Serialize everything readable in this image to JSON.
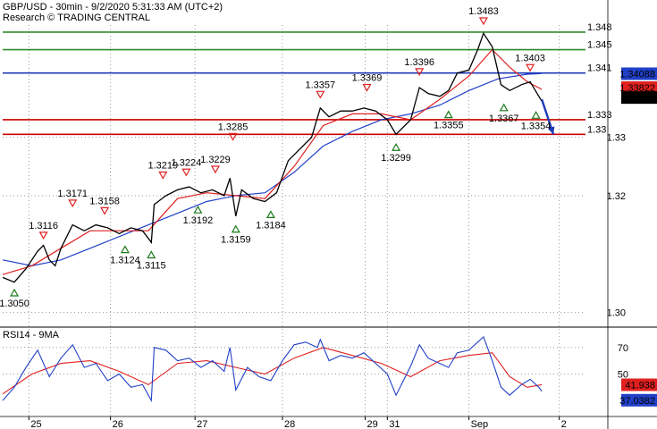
{
  "header": {
    "title": "GBP/USD - 30min - 9/2/2020 5:31:33 AM (UTC+2)",
    "subtitle": "Research © TRADING CENTRAL"
  },
  "colors": {
    "resistance": "#2e8b2e",
    "pivot": "#1f3ab8",
    "support": "#cc0000",
    "ma_red": "#e02020",
    "ma_blue": "#2040c8",
    "price": "#000000",
    "marker_down": "#e02020",
    "marker_up": "#1a7a1a",
    "grid": "#9a9a9a"
  },
  "icons": {
    "forecast_arrow": "arrow-down-right-icon",
    "marker_high": "triangle-down-icon",
    "marker_low": "triangle-up-icon"
  },
  "chart_data": [
    {
      "type": "line",
      "panel": "price",
      "ylim": [
        1.2975,
        1.3535
      ],
      "y_ticks": [
        "1.33",
        "1.32",
        "1.30"
      ],
      "x_ticks": [
        "25",
        "26",
        "27",
        "28",
        "29",
        "31",
        "Sep",
        "2"
      ],
      "levels": [
        {
          "label": "1.348",
          "value": 1.348,
          "role": "resistance"
        },
        {
          "label": "1.345",
          "value": 1.345,
          "role": "resistance"
        },
        {
          "label": "1.341",
          "value": 1.341,
          "role": "pivot"
        },
        {
          "label": "1.333",
          "value": 1.333,
          "role": "support"
        },
        {
          "label": "1.33",
          "value": 1.3305,
          "role": "support"
        }
      ],
      "last_price": "1.337",
      "ma_fast_value": "1.33822",
      "ma_slow_value": "1.34088",
      "annotations": [
        {
          "label": "1.3050",
          "value": 1.305,
          "type": "low",
          "x_pos": 0.02
        },
        {
          "label": "1.3116",
          "value": 1.3116,
          "type": "high",
          "x_pos": 0.07
        },
        {
          "label": "1.3171",
          "value": 1.3171,
          "type": "high",
          "x_pos": 0.12
        },
        {
          "label": "1.3158",
          "value": 1.3158,
          "type": "high",
          "x_pos": 0.175
        },
        {
          "label": "1.3124",
          "value": 1.3124,
          "type": "low",
          "x_pos": 0.21
        },
        {
          "label": "1.3115",
          "value": 1.3115,
          "type": "low",
          "x_pos": 0.255
        },
        {
          "label": "1.3219",
          "value": 1.3219,
          "type": "high",
          "x_pos": 0.275
        },
        {
          "label": "1.3224",
          "value": 1.3224,
          "type": "high",
          "x_pos": 0.315
        },
        {
          "label": "1.3192",
          "value": 1.3192,
          "type": "low",
          "x_pos": 0.335
        },
        {
          "label": "1.3229",
          "value": 1.3229,
          "type": "high",
          "x_pos": 0.365
        },
        {
          "label": "1.3285",
          "value": 1.3285,
          "type": "high",
          "x_pos": 0.395
        },
        {
          "label": "1.3159",
          "value": 1.3159,
          "type": "low",
          "x_pos": 0.4
        },
        {
          "label": "1.3184",
          "value": 1.3184,
          "type": "low",
          "x_pos": 0.46
        },
        {
          "label": "1.3357",
          "value": 1.3357,
          "type": "high",
          "x_pos": 0.545
        },
        {
          "label": "1.3369",
          "value": 1.3369,
          "type": "high",
          "x_pos": 0.625
        },
        {
          "label": "1.3299",
          "value": 1.3299,
          "type": "low",
          "x_pos": 0.675
        },
        {
          "label": "1.3396",
          "value": 1.3396,
          "type": "high",
          "x_pos": 0.715
        },
        {
          "label": "1.3355",
          "value": 1.3355,
          "type": "low",
          "x_pos": 0.765
        },
        {
          "label": "1.3483",
          "value": 1.3483,
          "type": "high",
          "x_pos": 0.825
        },
        {
          "label": "1.3367",
          "value": 1.3367,
          "type": "low",
          "x_pos": 0.86
        },
        {
          "label": "1.3403",
          "value": 1.3403,
          "type": "high",
          "x_pos": 0.905
        },
        {
          "label": "1.3354",
          "value": 1.3354,
          "type": "low",
          "x_pos": 0.915
        }
      ],
      "price_series": [
        [
          0.0,
          1.306
        ],
        [
          0.02,
          1.3052
        ],
        [
          0.04,
          1.3075
        ],
        [
          0.06,
          1.3105
        ],
        [
          0.07,
          1.3115
        ],
        [
          0.08,
          1.309
        ],
        [
          0.09,
          1.308
        ],
        [
          0.1,
          1.311
        ],
        [
          0.12,
          1.315
        ],
        [
          0.14,
          1.314
        ],
        [
          0.16,
          1.315
        ],
        [
          0.18,
          1.3145
        ],
        [
          0.2,
          1.3135
        ],
        [
          0.22,
          1.3145
        ],
        [
          0.24,
          1.314
        ],
        [
          0.255,
          1.312
        ],
        [
          0.26,
          1.3185
        ],
        [
          0.28,
          1.32
        ],
        [
          0.3,
          1.321
        ],
        [
          0.32,
          1.3215
        ],
        [
          0.34,
          1.3205
        ],
        [
          0.36,
          1.321
        ],
        [
          0.38,
          1.32
        ],
        [
          0.39,
          1.323
        ],
        [
          0.4,
          1.3165
        ],
        [
          0.41,
          1.321
        ],
        [
          0.43,
          1.3195
        ],
        [
          0.45,
          1.319
        ],
        [
          0.47,
          1.3205
        ],
        [
          0.49,
          1.326
        ],
        [
          0.51,
          1.328
        ],
        [
          0.53,
          1.33
        ],
        [
          0.545,
          1.335
        ],
        [
          0.56,
          1.3335
        ],
        [
          0.58,
          1.3345
        ],
        [
          0.6,
          1.3345
        ],
        [
          0.62,
          1.335
        ],
        [
          0.64,
          1.3345
        ],
        [
          0.66,
          1.333
        ],
        [
          0.675,
          1.3305
        ],
        [
          0.7,
          1.333
        ],
        [
          0.715,
          1.3385
        ],
        [
          0.73,
          1.3375
        ],
        [
          0.75,
          1.337
        ],
        [
          0.765,
          1.338
        ],
        [
          0.78,
          1.341
        ],
        [
          0.8,
          1.3415
        ],
        [
          0.815,
          1.345
        ],
        [
          0.825,
          1.3478
        ],
        [
          0.84,
          1.3455
        ],
        [
          0.855,
          1.339
        ],
        [
          0.87,
          1.338
        ],
        [
          0.89,
          1.339
        ],
        [
          0.905,
          1.3395
        ],
        [
          0.92,
          1.337
        ],
        [
          0.925,
          1.3362
        ]
      ],
      "ma_fast_series": [
        [
          0.0,
          1.3065
        ],
        [
          0.05,
          1.308
        ],
        [
          0.1,
          1.311
        ],
        [
          0.15,
          1.314
        ],
        [
          0.2,
          1.314
        ],
        [
          0.25,
          1.314
        ],
        [
          0.3,
          1.3195
        ],
        [
          0.35,
          1.3205
        ],
        [
          0.4,
          1.32
        ],
        [
          0.45,
          1.3195
        ],
        [
          0.5,
          1.325
        ],
        [
          0.55,
          1.332
        ],
        [
          0.6,
          1.334
        ],
        [
          0.65,
          1.334
        ],
        [
          0.7,
          1.333
        ],
        [
          0.75,
          1.3365
        ],
        [
          0.8,
          1.3405
        ],
        [
          0.84,
          1.345
        ],
        [
          0.87,
          1.342
        ],
        [
          0.9,
          1.3395
        ],
        [
          0.925,
          1.3382
        ]
      ],
      "ma_slow_series": [
        [
          0.0,
          1.309
        ],
        [
          0.05,
          1.308
        ],
        [
          0.1,
          1.309
        ],
        [
          0.15,
          1.311
        ],
        [
          0.2,
          1.313
        ],
        [
          0.25,
          1.315
        ],
        [
          0.3,
          1.317
        ],
        [
          0.35,
          1.319
        ],
        [
          0.4,
          1.32
        ],
        [
          0.45,
          1.3205
        ],
        [
          0.5,
          1.324
        ],
        [
          0.55,
          1.3285
        ],
        [
          0.6,
          1.331
        ],
        [
          0.65,
          1.333
        ],
        [
          0.7,
          1.334
        ],
        [
          0.75,
          1.3355
        ],
        [
          0.8,
          1.338
        ],
        [
          0.85,
          1.34
        ],
        [
          0.9,
          1.3408
        ],
        [
          0.925,
          1.3409
        ]
      ],
      "forecast": [
        [
          0.925,
          1.3365
        ],
        [
          0.945,
          1.3305
        ]
      ]
    },
    {
      "type": "line",
      "panel": "indicator",
      "title": "RSI14 - 9MA",
      "ylim": [
        18,
        84
      ],
      "y_ticks": [
        "70",
        "50"
      ],
      "rsi_value": "37.0382",
      "ma_value": "41.938",
      "rsi_series": [
        [
          0.0,
          30
        ],
        [
          0.02,
          40
        ],
        [
          0.04,
          55
        ],
        [
          0.06,
          68
        ],
        [
          0.08,
          48
        ],
        [
          0.1,
          62
        ],
        [
          0.12,
          72
        ],
        [
          0.14,
          55
        ],
        [
          0.16,
          58
        ],
        [
          0.18,
          45
        ],
        [
          0.2,
          50
        ],
        [
          0.22,
          40
        ],
        [
          0.24,
          42
        ],
        [
          0.255,
          30
        ],
        [
          0.26,
          70
        ],
        [
          0.28,
          68
        ],
        [
          0.3,
          60
        ],
        [
          0.32,
          62
        ],
        [
          0.34,
          55
        ],
        [
          0.36,
          60
        ],
        [
          0.38,
          52
        ],
        [
          0.39,
          70
        ],
        [
          0.4,
          38
        ],
        [
          0.42,
          55
        ],
        [
          0.44,
          48
        ],
        [
          0.46,
          45
        ],
        [
          0.48,
          60
        ],
        [
          0.5,
          72
        ],
        [
          0.52,
          74
        ],
        [
          0.54,
          70
        ],
        [
          0.545,
          76
        ],
        [
          0.56,
          60
        ],
        [
          0.58,
          64
        ],
        [
          0.6,
          62
        ],
        [
          0.62,
          66
        ],
        [
          0.64,
          58
        ],
        [
          0.66,
          50
        ],
        [
          0.675,
          34
        ],
        [
          0.7,
          56
        ],
        [
          0.715,
          72
        ],
        [
          0.73,
          62
        ],
        [
          0.75,
          58
        ],
        [
          0.765,
          55
        ],
        [
          0.78,
          66
        ],
        [
          0.8,
          68
        ],
        [
          0.815,
          74
        ],
        [
          0.825,
          78
        ],
        [
          0.84,
          60
        ],
        [
          0.855,
          40
        ],
        [
          0.87,
          34
        ],
        [
          0.89,
          42
        ],
        [
          0.905,
          46
        ],
        [
          0.92,
          40
        ],
        [
          0.925,
          37
        ]
      ],
      "ma_series": [
        [
          0.0,
          35
        ],
        [
          0.05,
          50
        ],
        [
          0.1,
          58
        ],
        [
          0.15,
          60
        ],
        [
          0.2,
          52
        ],
        [
          0.25,
          42
        ],
        [
          0.3,
          58
        ],
        [
          0.35,
          60
        ],
        [
          0.4,
          55
        ],
        [
          0.45,
          50
        ],
        [
          0.5,
          62
        ],
        [
          0.55,
          70
        ],
        [
          0.6,
          64
        ],
        [
          0.65,
          58
        ],
        [
          0.7,
          48
        ],
        [
          0.75,
          60
        ],
        [
          0.8,
          64
        ],
        [
          0.84,
          66
        ],
        [
          0.87,
          48
        ],
        [
          0.9,
          40
        ],
        [
          0.925,
          42
        ]
      ]
    }
  ]
}
